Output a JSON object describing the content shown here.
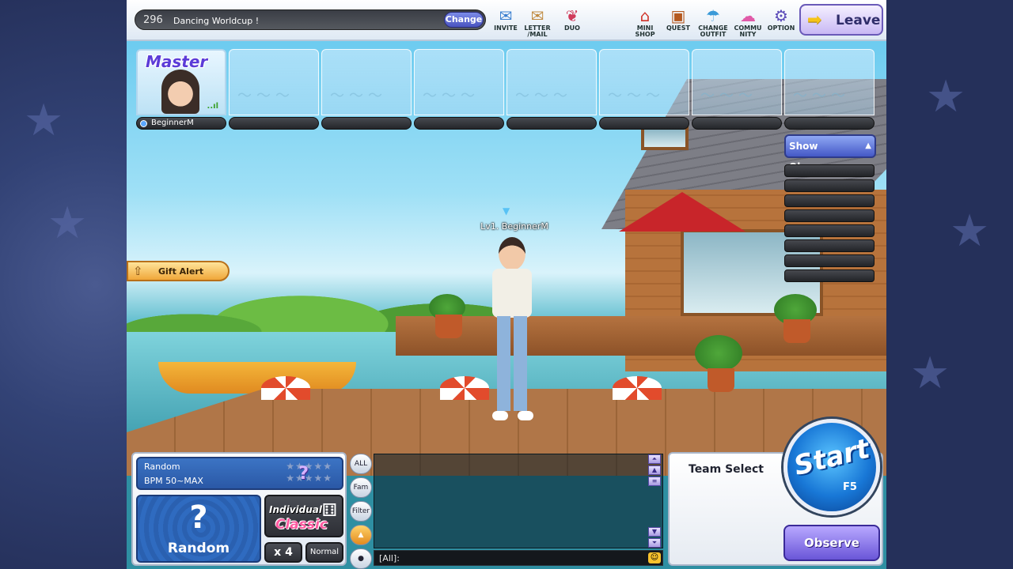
{
  "room": {
    "number": "296",
    "name": "Dancing Worldcup !",
    "change_label": "Change"
  },
  "toolbar": {
    "invite": "INVITE",
    "letter_mail": "LETTER\n/MAIL",
    "duo": "DUO",
    "mini_shop": "MINI\nSHOP",
    "quest": "QUEST",
    "change_outfit": "CHANGE\nOUTFIT",
    "community": "COMMU\nNITY",
    "option": "OPTION",
    "leave": "Leave"
  },
  "slots": {
    "master_badge": "Master",
    "player_name": "BeginnerM",
    "signal": "..ıl"
  },
  "character": {
    "label": "Lv1. BeginnerM"
  },
  "observers": {
    "show_label": "Show Observers"
  },
  "gift_alert": {
    "label": "Gift Alert"
  },
  "song": {
    "title": "Random",
    "bpm": "BPM 50~MAX",
    "question": "?",
    "random_symbol": "?",
    "random_label": "Random",
    "mode_line1": "Individual",
    "mode_line2": "Classic",
    "speed": "x 4",
    "difficulty": "Normal"
  },
  "chat": {
    "tabs": [
      "ALL",
      "Fam",
      "Filter"
    ],
    "input_prefix": "[All]:"
  },
  "team": {
    "label": "Team Select",
    "start_label": "Start",
    "start_key": "F5",
    "observe_label": "Observe"
  },
  "icons": {
    "invite": "envelope-icon",
    "letter": "letter-icon",
    "duo": "wings-icon",
    "mini_shop": "shop-icon",
    "quest": "scroll-icon",
    "change_outfit": "outfit-icon",
    "community": "cloud-icon",
    "option": "gear-icon",
    "leave": "arrow-right-icon",
    "gift": "gift-icon"
  },
  "colors": {
    "accent_blue": "#1877d6",
    "leave_purple": "#6a5ab8",
    "gift_orange": "#f0a73a",
    "classic_pink": "#ff5aa0"
  }
}
